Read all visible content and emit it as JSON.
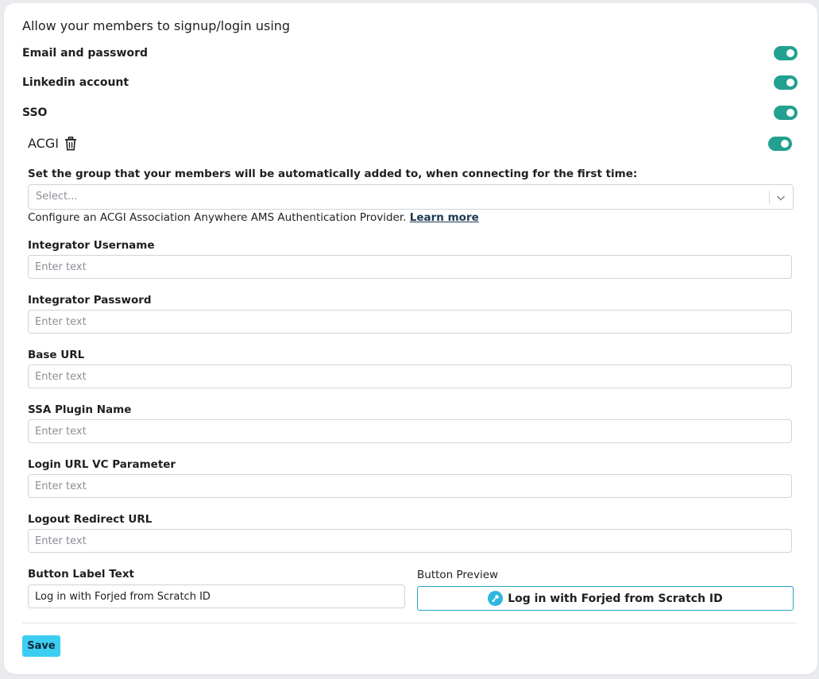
{
  "heading": "Allow your members to signup/login using",
  "methods": [
    {
      "label": "Email and password",
      "enabled": true
    },
    {
      "label": "Linkedin account",
      "enabled": true
    },
    {
      "label": "SSO",
      "enabled": true
    }
  ],
  "provider": {
    "name": "ACGI",
    "enabled": true,
    "group_label": "Set the group that your members will be automatically added to, when connecting for the first time:",
    "group_placeholder": "Select...",
    "help_text": "Configure an ACGI Association Anywhere AMS Authentication Provider.",
    "learn_more": "Learn more",
    "fields": [
      {
        "label": "Integrator Username",
        "placeholder": "Enter text",
        "value": ""
      },
      {
        "label": "Integrator Password",
        "placeholder": "Enter text",
        "value": ""
      },
      {
        "label": "Base URL",
        "placeholder": "Enter text",
        "value": ""
      },
      {
        "label": "SSA Plugin Name",
        "placeholder": "Enter text",
        "value": ""
      },
      {
        "label": "Login URL VC Parameter",
        "placeholder": "Enter text",
        "value": ""
      },
      {
        "label": "Logout Redirect URL",
        "placeholder": "Enter text",
        "value": ""
      }
    ],
    "button_label": {
      "label": "Button Label Text",
      "value": "Log in with Forjed from Scratch ID"
    },
    "button_preview": {
      "label": "Button Preview",
      "text": "Log in with Forjed from Scratch ID"
    }
  },
  "save_label": "Save",
  "colors": {
    "toggle_on": "#22a090",
    "save_button": "#3ccdf2",
    "preview_border": "#2aa3c4",
    "preview_icon": "#2fb6e0"
  },
  "icons": {
    "delete": "trash-icon",
    "select": "chevron-down-icon",
    "preview": "key-icon"
  }
}
